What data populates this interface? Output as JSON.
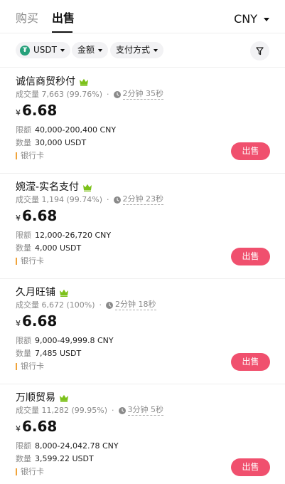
{
  "tabs": {
    "buy": "购买",
    "sell": "出售"
  },
  "currency": "CNY",
  "filters": {
    "asset": "USDT",
    "amount": "金额",
    "payment": "支付方式"
  },
  "colors": {
    "sell_button": "#f0506e",
    "crown": "#7cc11a",
    "tether": "#26a17b",
    "payment_bar": "#f0a33a"
  },
  "labels": {
    "volume": "成交量",
    "limit": "限额",
    "quantity": "数量",
    "currency_symbol": "¥",
    "sell": "出售"
  },
  "listings": [
    {
      "name": "诚信商贸秒付",
      "volume": "7,663",
      "rate": "(99.76%)",
      "time": "2分钟 35秒",
      "price": "6.68",
      "limit": "40,000-200,400 CNY",
      "quantity": "30,000 USDT",
      "payment": "银行卡"
    },
    {
      "name": "婉滢-实名支付",
      "volume": "1,194",
      "rate": "(99.74%)",
      "time": "2分钟 23秒",
      "price": "6.68",
      "limit": "12,000-26,720 CNY",
      "quantity": "4,000 USDT",
      "payment": "银行卡"
    },
    {
      "name": "久月旺铺",
      "volume": "6,672",
      "rate": "(100%)",
      "time": "2分钟 18秒",
      "price": "6.68",
      "limit": "9,000-49,999.8 CNY",
      "quantity": "7,485 USDT",
      "payment": "银行卡"
    },
    {
      "name": "万顺贸易",
      "volume": "11,282",
      "rate": "(99.95%)",
      "time": "3分钟 5秒",
      "price": "6.68",
      "limit": "8,000-24,042.78 CNY",
      "quantity": "3,599.22 USDT",
      "payment": "银行卡"
    }
  ]
}
